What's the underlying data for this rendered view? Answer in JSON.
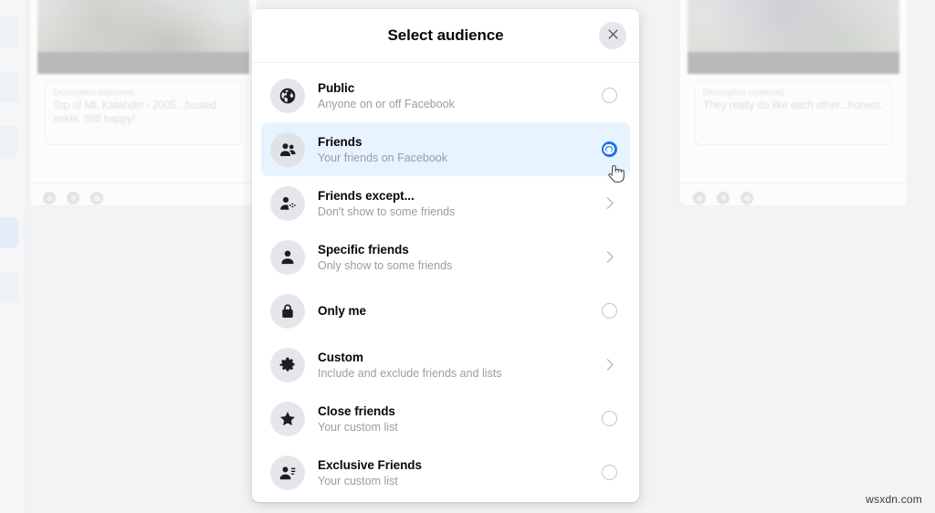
{
  "background": {
    "left_card": {
      "description_placeholder": "Description (optional)",
      "description_text": "Top of Mt. Katahdin - 2005...busted ankle.  Still happy!"
    },
    "right_card": {
      "description_placeholder": "Description (optional)",
      "description_text": "They really do like each other...honest."
    }
  },
  "modal": {
    "title": "Select audience",
    "close_label": "Close",
    "accent_color": "#1b74e4",
    "selected_row_color": "#e7f3fe",
    "options": [
      {
        "icon": "globe-icon",
        "title": "Public",
        "subtitle": "Anyone on or off Facebook",
        "control": "radio",
        "selected": false
      },
      {
        "icon": "friends-icon",
        "title": "Friends",
        "subtitle": "Your friends on Facebook",
        "control": "radio",
        "selected": true
      },
      {
        "icon": "friends-except-icon",
        "title": "Friends except...",
        "subtitle": "Don't show to some friends",
        "control": "chevron",
        "selected": false
      },
      {
        "icon": "specific-friends-icon",
        "title": "Specific friends",
        "subtitle": "Only show to some friends",
        "control": "chevron",
        "selected": false
      },
      {
        "icon": "lock-icon",
        "title": "Only me",
        "subtitle": "",
        "control": "radio",
        "selected": false
      },
      {
        "icon": "gear-icon",
        "title": "Custom",
        "subtitle": "Include and exclude friends and lists",
        "control": "chevron",
        "selected": false
      },
      {
        "icon": "star-icon",
        "title": "Close friends",
        "subtitle": "Your custom list",
        "control": "radio",
        "selected": false
      },
      {
        "icon": "list-person-icon",
        "title": "Exclusive Friends",
        "subtitle": "Your custom list",
        "control": "radio",
        "selected": false
      }
    ]
  },
  "watermark": {
    "text": "wsxdn.com"
  }
}
